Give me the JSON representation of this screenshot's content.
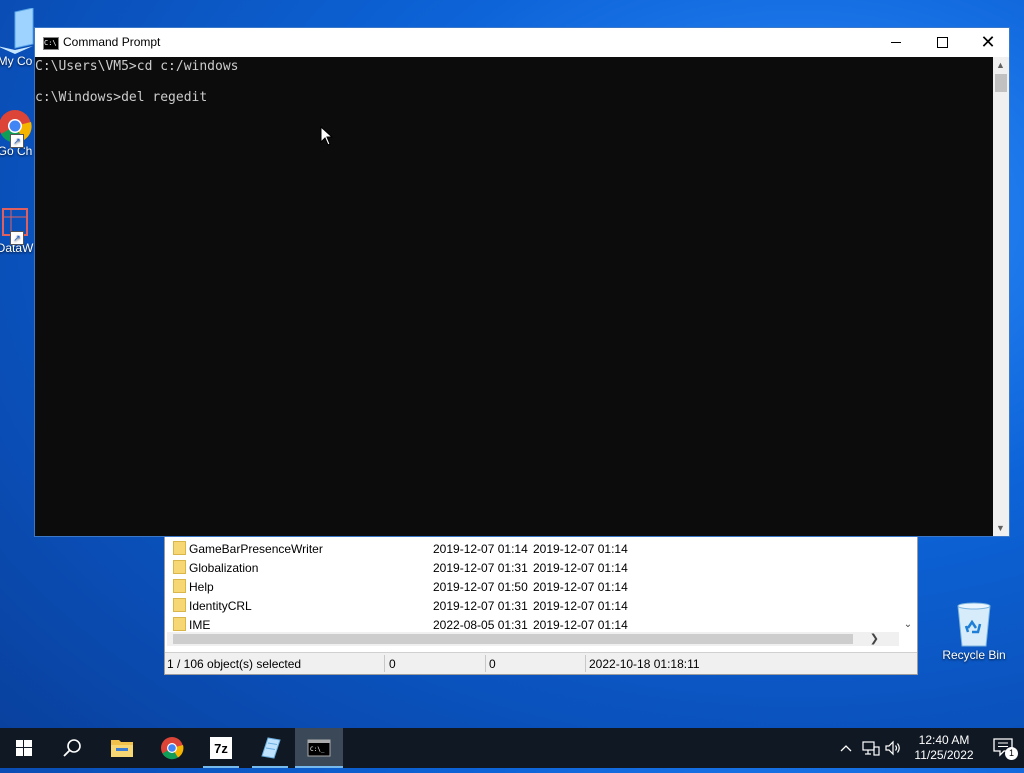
{
  "desktop": {
    "icons": [
      {
        "label": "My Co"
      },
      {
        "label": "Go Ch"
      },
      {
        "label": "DataW"
      },
      {
        "label": "Recycle Bin"
      }
    ]
  },
  "explorer": {
    "files": [
      {
        "name": "GameBarPresenceWriter",
        "modified": "2019-12-07 01:14",
        "created": "2019-12-07 01:14"
      },
      {
        "name": "Globalization",
        "modified": "2019-12-07 01:31",
        "created": "2019-12-07 01:14"
      },
      {
        "name": "Help",
        "modified": "2019-12-07 01:50",
        "created": "2019-12-07 01:14"
      },
      {
        "name": "IdentityCRL",
        "modified": "2019-12-07 01:31",
        "created": "2019-12-07 01:14"
      },
      {
        "name": "IME",
        "modified": "2022-08-05 01:31",
        "created": "2019-12-07 01:14"
      }
    ],
    "status": {
      "selection": "1 / 106 object(s) selected",
      "size": "0",
      "packed": "0",
      "date": "2022-10-18 01:18:11"
    }
  },
  "cmd": {
    "title": "Command Prompt",
    "lines": [
      "C:\\Users\\VM5>cd c:/windows",
      "",
      "c:\\Windows>del regedit"
    ]
  },
  "taskbar": {
    "apps": [
      "start",
      "search",
      "file-explorer",
      "chrome",
      "7-zip",
      "notepad",
      "command-prompt"
    ],
    "clock": {
      "time": "12:40 AM",
      "date": "11/25/2022"
    },
    "notifications": "1"
  },
  "colors": {
    "accent": "#76b9ed",
    "console_bg": "#0c0c0c",
    "console_fg": "#cccccc",
    "taskbar_bg": "#101923"
  }
}
